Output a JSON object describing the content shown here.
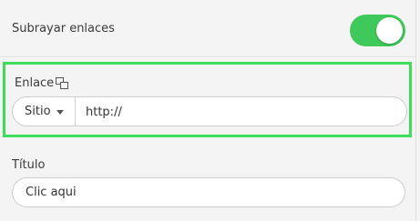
{
  "underline_links": {
    "label": "Subrayar enlaces",
    "enabled": true,
    "toggle_color": "#3ec95a"
  },
  "link": {
    "label": "Enlace",
    "icon": "copy-link-icon",
    "target_select": {
      "selected": "Sitio",
      "icon": "caret-down-icon"
    },
    "url_value": "http://",
    "highlight_color": "#3ddc5b"
  },
  "title": {
    "label": "Título",
    "value": "Clic aqui"
  }
}
